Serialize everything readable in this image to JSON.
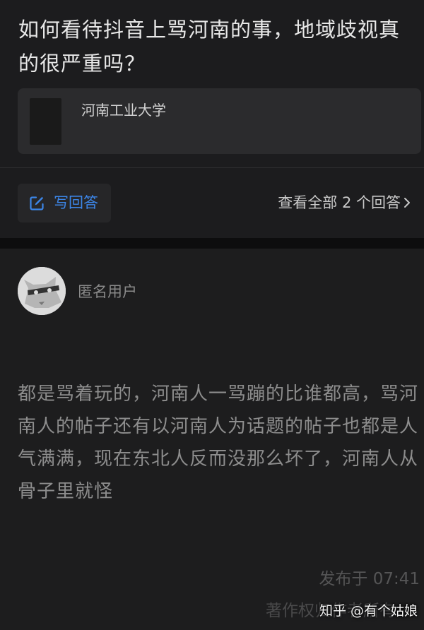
{
  "question": {
    "title": "如何看待抖音上骂河南的事，地域歧视真的很严重吗？",
    "topic": "河南工业大学"
  },
  "actions": {
    "write_answer": "写回答",
    "view_all": "查看全部 2 个回答"
  },
  "answer": {
    "author": "匿名用户",
    "content": "都是骂着玩的，河南人一骂蹦的比谁都高，骂河南人的帖子还有以河南人为话题的帖子也都是人气满满，现在东北人反而没那么坏了，河南人从骨子里就怪",
    "published": "发布于 07:41",
    "copyright": "著作权归作者所有"
  },
  "watermark": "知乎 @有个姑娘",
  "colors": {
    "accent": "#3c86e8",
    "background": "#1c1c1e"
  },
  "icons": {
    "write": "pencil-square-icon",
    "chevron": "chevron-right-icon",
    "avatar": "anonymous-avatar-icon"
  }
}
